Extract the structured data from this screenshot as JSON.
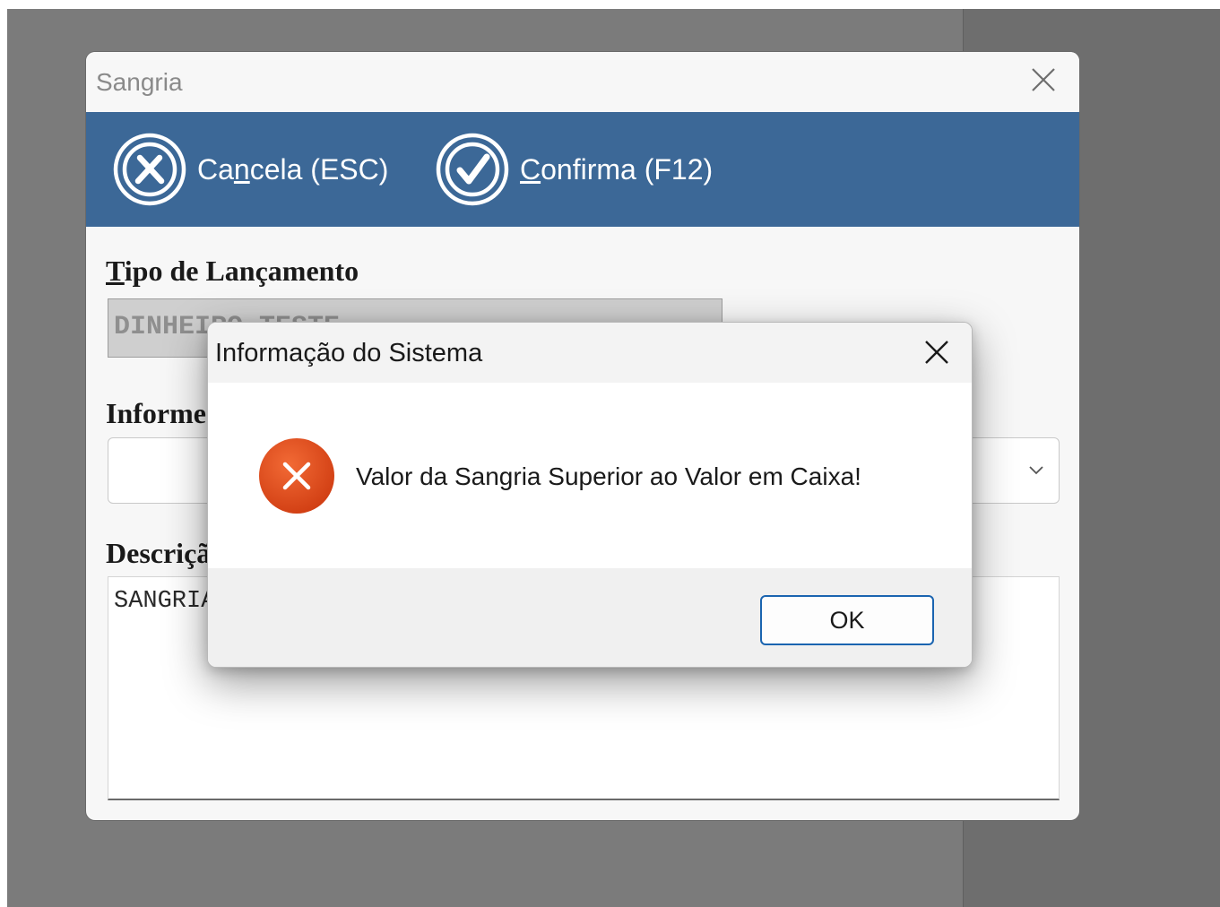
{
  "main_window": {
    "title": "Sangria",
    "toolbar": {
      "cancel": {
        "pre": "Ca",
        "mnemonic": "n",
        "post": "cela (ESC)"
      },
      "confirm": {
        "pre": "",
        "mnemonic": "C",
        "post": "onfirma (F12)"
      }
    },
    "tipo": {
      "label_mnemonic": "T",
      "label_rest": "ipo de Lançamento",
      "value": "DINHEIRO TESTE"
    },
    "info": {
      "label": "Informe"
    },
    "descricao": {
      "label": "Descrição",
      "value": "SANGRIA"
    }
  },
  "message_dialog": {
    "title": "Informação do Sistema",
    "message": "Valor da Sangria Superior ao Valor em Caixa!",
    "ok_label": "OK"
  },
  "colors": {
    "toolbar": "#3c6897",
    "error_icon": "#e04a1c",
    "ok_border": "#1a64b0"
  },
  "icons": {
    "cancel": "circle-x-icon",
    "confirm": "circle-check-icon",
    "error": "error-icon",
    "close": "close-icon",
    "dropdown": "chevron-down-icon"
  }
}
